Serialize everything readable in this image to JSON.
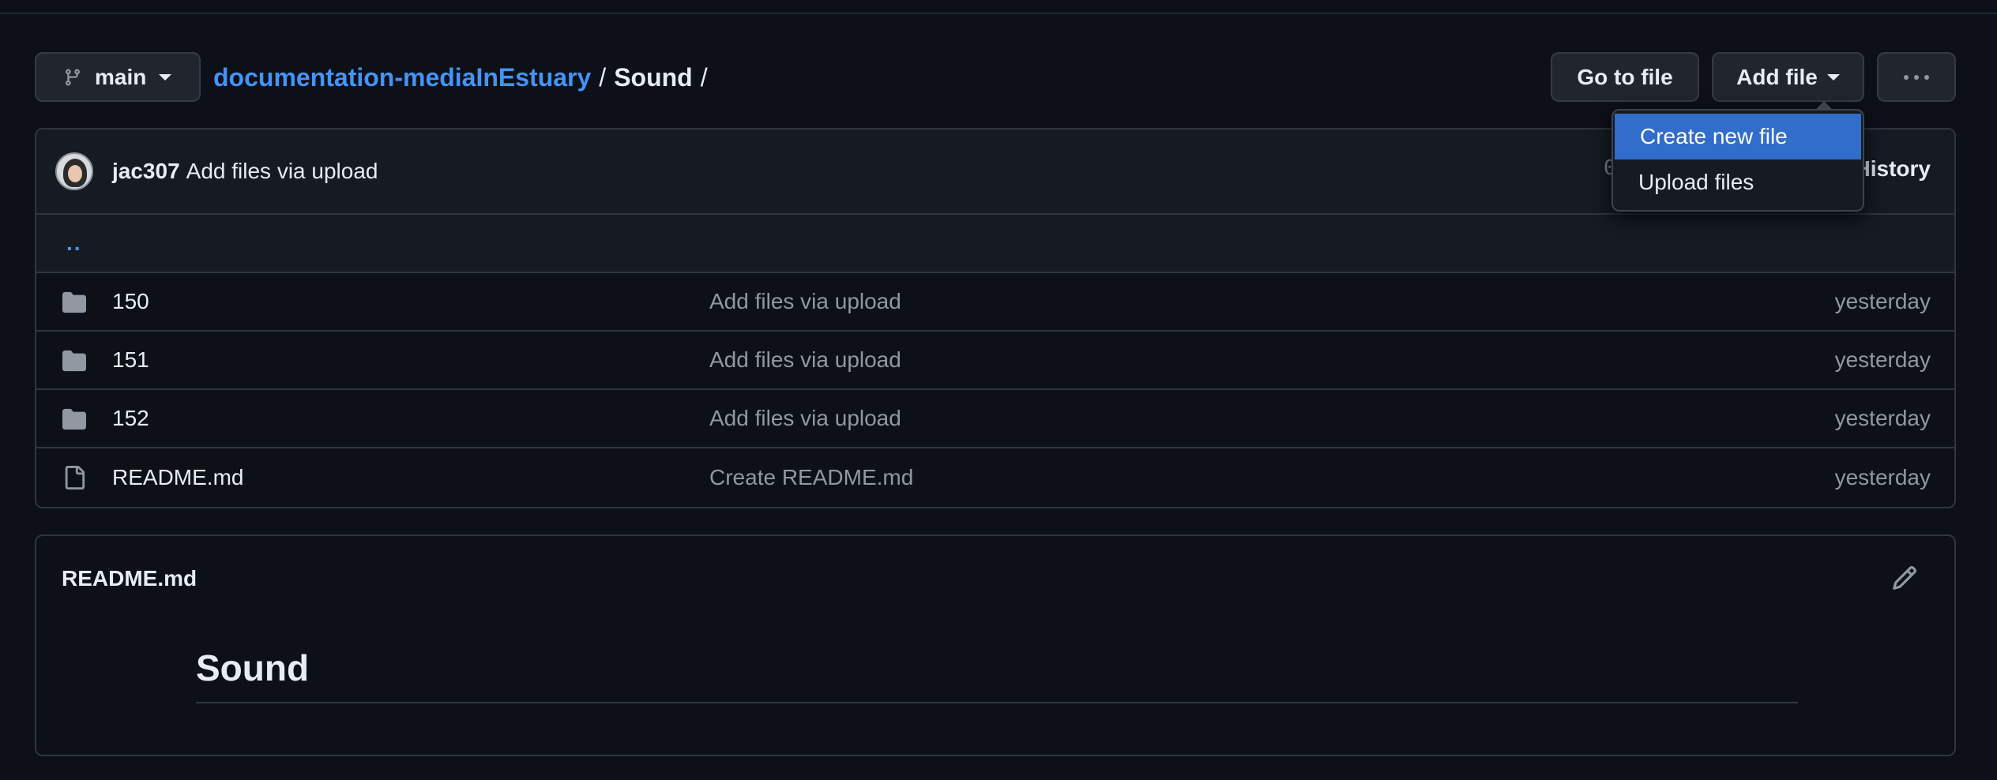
{
  "branch": {
    "name": "main"
  },
  "breadcrumb": {
    "repo": "documentation-mediaInEstuary",
    "sep1": "/",
    "dir": "Sound",
    "sep2": "/"
  },
  "actions": {
    "goto_label": "Go to file",
    "addfile_label": "Add file",
    "more_icon": "kebab-horizontal-icon"
  },
  "addfile_menu": {
    "items": [
      {
        "label": "Create new file"
      },
      {
        "label": "Upload files"
      }
    ]
  },
  "commit": {
    "author": "jac307",
    "message": "Add files via upload",
    "hash_fragment": "0",
    "history_label": "History"
  },
  "parent_dir": {
    "label": ".."
  },
  "files": [
    {
      "name": "150",
      "type": "folder",
      "message": "Add files via upload",
      "date": "yesterday"
    },
    {
      "name": "151",
      "type": "folder",
      "message": "Add files via upload",
      "date": "yesterday"
    },
    {
      "name": "152",
      "type": "folder",
      "message": "Add files via upload",
      "date": "yesterday"
    },
    {
      "name": "README.md",
      "type": "file",
      "message": "Create README.md",
      "date": "yesterday"
    }
  ],
  "readme": {
    "title": "README.md",
    "heading": "Sound"
  },
  "colors": {
    "background": "#0d1117",
    "accent_link": "#4493f8",
    "menu_active": "#316dca",
    "border": "#30363d"
  }
}
